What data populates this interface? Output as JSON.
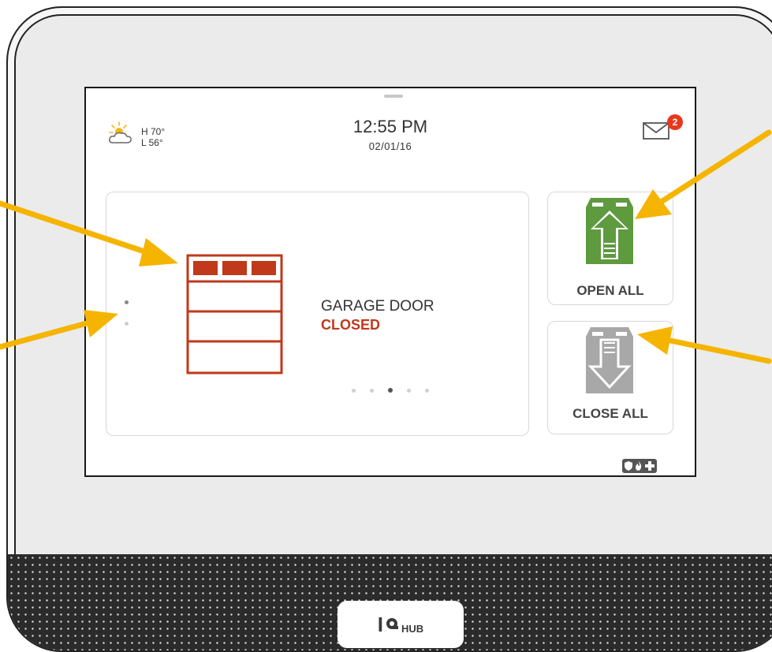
{
  "header": {
    "weather_high": "H 70°",
    "weather_low": "L 56°",
    "time": "12:55 PM",
    "date": "02/01/16",
    "message_badge": "2"
  },
  "garage": {
    "label": "GARAGE DOOR",
    "status": "CLOSED"
  },
  "actions": {
    "open_all": "OPEN ALL",
    "close_all": "CLOSE ALL"
  },
  "pager": {
    "pages": 5,
    "active": 3
  },
  "logo": {
    "mark": "I",
    "text": "HUB"
  },
  "colors": {
    "garage_red": "#c0391b",
    "open_green": "#5e9a3e",
    "close_gray": "#a8a8a8",
    "badge_red": "#e8371d",
    "arrow_yellow": "#f5b400"
  },
  "icons": [
    "weather-partly-sunny-icon",
    "mail-icon",
    "garage-door-icon",
    "open-all-garage-icon",
    "close-all-garage-icon",
    "security-icon",
    "fire-icon",
    "medical-icon"
  ]
}
